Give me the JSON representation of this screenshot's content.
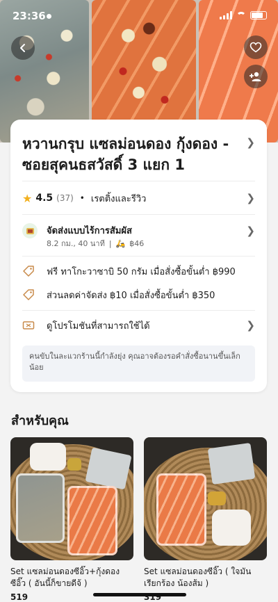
{
  "status_bar": {
    "time": "23:36"
  },
  "store": {
    "title": "หวานกรุบ แซลม่อนดอง กุ้งดอง - ซอยสุคนธสวัสดิ์ 3 แยก 1",
    "rating": "4.5",
    "rating_count": "(37)",
    "rating_link": "เรตติ้งและรีวิว",
    "delivery_title": "จัดส่งแบบไร้การสัมผัส",
    "delivery_info": "8.2 กม., 40 นาที",
    "delivery_fee": "฿46",
    "promo_1": "ฟรี ทาโกะวาซาบิ 50 กรัม เมื่อสั่งซื้อขั้นต่ำ ฿990",
    "promo_2": "ส่วนลดค่าจัดส่ง ฿10 เมื่อสั่งซื้อขั้นต่ำ ฿350",
    "promo_3": "ดูโปรโมชันที่สามารถใช้ได้",
    "notice": "คนขับในละแวกร้านนี้กำลังยุ่ง คุณอาจต้องรอคำสั่งซื้อนานขึ้นเล็กน้อย"
  },
  "for_you": {
    "title": "สำหรับคุณ",
    "items": [
      {
        "name": "Set แซลม่อนดองซีอิ๊ว+กุ้งดองซีอิ๊ว ( อันนี้ก็ขายดีจ้ )",
        "price": "519"
      },
      {
        "name": "Set แซลม่อนดองซีอิ๊ว ( ใจมันเรียกร้อง น้องส้ม )",
        "price": "319"
      }
    ]
  },
  "icons": [
    "chevron-left-icon",
    "heart-icon",
    "add-user-icon",
    "star-icon",
    "chevron-right-icon",
    "delivery-icon",
    "motorbike-icon",
    "tag-icon",
    "ticket-icon"
  ],
  "colors": {
    "star": "#f2b01e",
    "promo_icon": "#c88a4a",
    "notice_bg": "#f1f3f7"
  }
}
